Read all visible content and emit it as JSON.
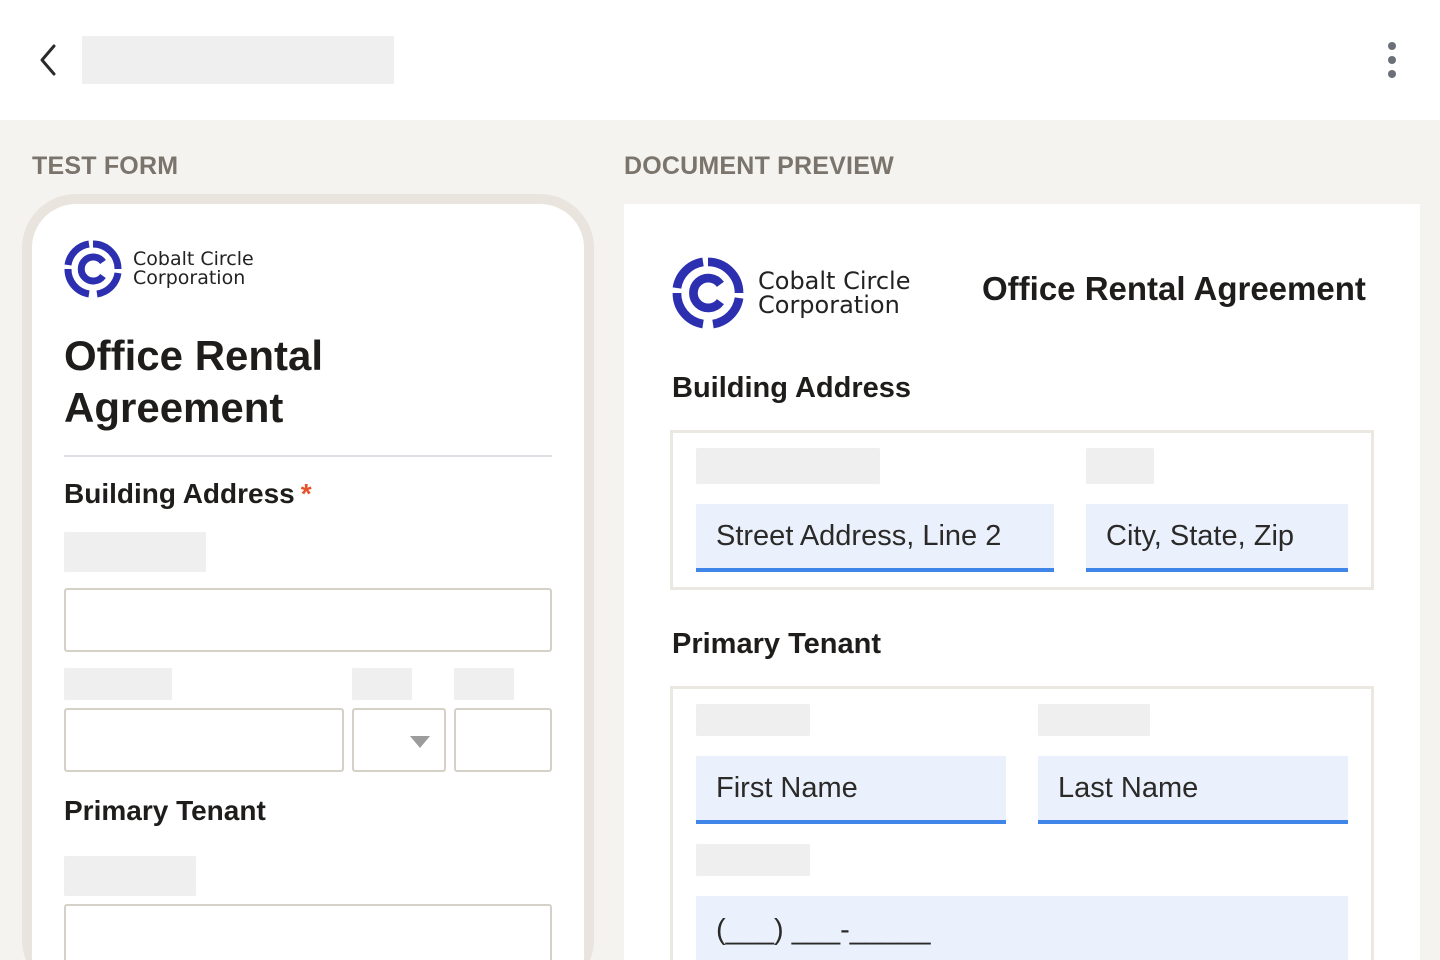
{
  "header": {
    "back_icon": "chevron-left-icon",
    "more_icon": "more-vertical-icon"
  },
  "test_form": {
    "section_label": "TEST FORM",
    "logo": {
      "line1": "Cobalt Circle",
      "line2": "Corporation",
      "color": "#2b2fb0"
    },
    "title": "Office Rental Agreement",
    "building_address": {
      "heading": "Building Address",
      "required_mark": "*"
    },
    "primary_tenant": {
      "heading": "Primary Tenant"
    }
  },
  "document_preview": {
    "section_label": "DOCUMENT PREVIEW",
    "logo": {
      "line1": "Cobalt Circle",
      "line2": "Corporation",
      "color": "#2b2fb0"
    },
    "title": "Office Rental Agreement",
    "building_address": {
      "heading": "Building Address",
      "street_line2": "Street Address, Line 2",
      "city_state_zip": "City, State, Zip"
    },
    "primary_tenant": {
      "heading": "Primary Tenant",
      "first_name": "First Name",
      "last_name": "Last Name",
      "phone": "(___) ___-_____"
    }
  },
  "colors": {
    "accent_blue": "#3f86e8",
    "field_fill": "#eaf1fd",
    "required": "#e5532a",
    "brand": "#2b2fb0"
  }
}
